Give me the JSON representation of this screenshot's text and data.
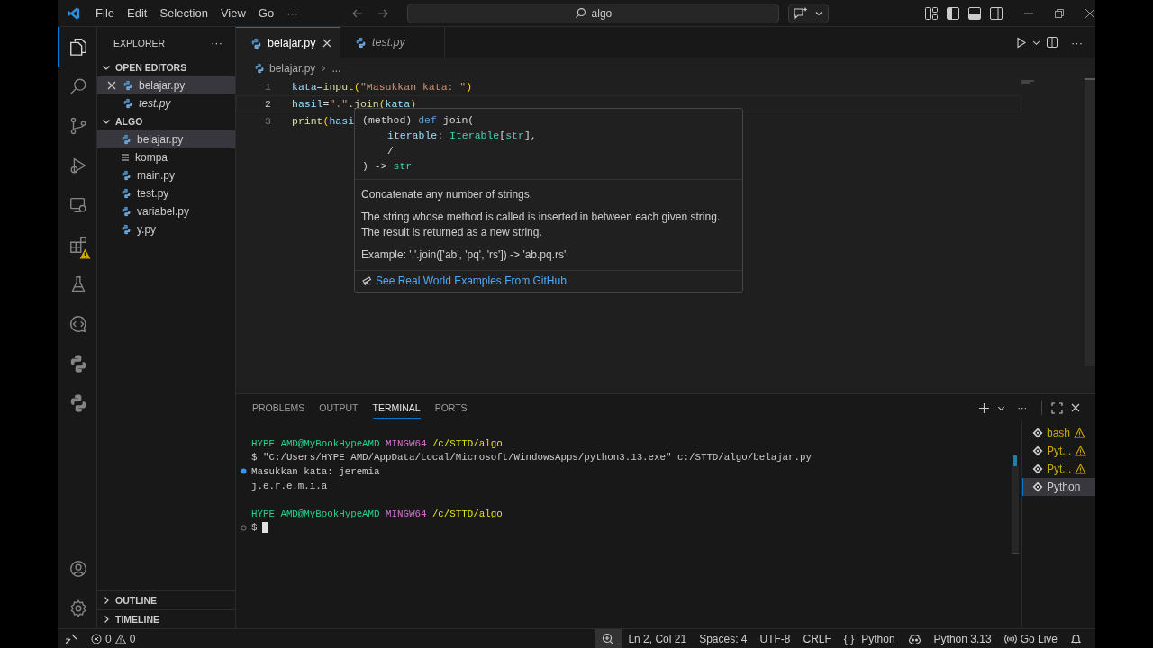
{
  "title_bar": {
    "menus": [
      "File",
      "Edit",
      "Selection",
      "View",
      "Go"
    ],
    "more": "···",
    "search": "algo"
  },
  "activity_bar": {
    "top": [
      {
        "kind": "files",
        "selected": true,
        "warning": false
      },
      {
        "kind": "search",
        "selected": false,
        "warning": false
      },
      {
        "kind": "source-control",
        "selected": false,
        "warning": false
      },
      {
        "kind": "run-debug",
        "selected": false,
        "warning": false
      },
      {
        "kind": "remote",
        "selected": false,
        "warning": false
      },
      {
        "kind": "extensions",
        "selected": false,
        "warning": true
      },
      {
        "kind": "testing",
        "selected": false,
        "warning": false
      },
      {
        "kind": "chat",
        "selected": false,
        "warning": false
      },
      {
        "kind": "python",
        "selected": false,
        "warning": false
      },
      {
        "kind": "python",
        "selected": false,
        "warning": false
      }
    ],
    "bottom": [
      {
        "kind": "account"
      },
      {
        "kind": "settings"
      }
    ]
  },
  "explorer": {
    "title": "EXPLORER",
    "more": "···",
    "sections": [
      {
        "title": "OPEN EDITORS",
        "expanded": true,
        "items": [
          {
            "name": "belajar.py",
            "kind": "python",
            "selected": true,
            "preview": false,
            "closable": true
          },
          {
            "name": "test.py",
            "kind": "python",
            "selected": false,
            "preview": true,
            "closable": false
          }
        ]
      },
      {
        "title": "ALGO",
        "expanded": true,
        "items": [
          {
            "name": "belajar.py",
            "kind": "python",
            "selected": true,
            "preview": false
          },
          {
            "name": "kompa",
            "kind": "text",
            "selected": false,
            "preview": false
          },
          {
            "name": "main.py",
            "kind": "python",
            "selected": false,
            "preview": false
          },
          {
            "name": "test.py",
            "kind": "python",
            "selected": false,
            "preview": false
          },
          {
            "name": "variabel.py",
            "kind": "python",
            "selected": false,
            "preview": false
          },
          {
            "name": "y.py",
            "kind": "python",
            "selected": false,
            "preview": false
          }
        ]
      }
    ],
    "bottom_sections": [
      {
        "title": "OUTLINE",
        "expanded": false
      },
      {
        "title": "TIMELINE",
        "expanded": false
      }
    ]
  },
  "tabs": [
    {
      "label": "belajar.py",
      "selected": true,
      "preview": false,
      "closable": true
    },
    {
      "label": "test.py",
      "selected": false,
      "preview": true,
      "closable": false
    }
  ],
  "breadcrumb": {
    "file": "belajar.py",
    "more": "..."
  },
  "editor": {
    "lines": [
      {
        "number": "1",
        "current": false,
        "tokens": [
          {
            "text": "kata",
            "kind": "var"
          },
          {
            "text": "=",
            "kind": "op"
          },
          {
            "text": "input",
            "kind": "fn"
          },
          {
            "text": "(",
            "kind": "paren"
          },
          {
            "text": "\"Masukkan kata: \"",
            "kind": "str"
          },
          {
            "text": ")",
            "kind": "paren"
          }
        ]
      },
      {
        "number": "2",
        "current": true,
        "tokens": [
          {
            "text": "hasil",
            "kind": "var"
          },
          {
            "text": "=",
            "kind": "op"
          },
          {
            "text": "\".\"",
            "kind": "str"
          },
          {
            "text": ".",
            "kind": "op"
          },
          {
            "text": "join",
            "kind": "fn"
          },
          {
            "text": "(",
            "kind": "paren"
          },
          {
            "text": "kata",
            "kind": "var"
          },
          {
            "text": ")",
            "kind": "paren"
          }
        ]
      },
      {
        "number": "3",
        "current": false,
        "tokens": [
          {
            "text": "print",
            "kind": "fn"
          },
          {
            "text": "(",
            "kind": "paren"
          },
          {
            "text": "hasi",
            "kind": "var"
          }
        ]
      }
    ]
  },
  "hover": {
    "signature": [
      {
        "indented": false,
        "tokens": [
          {
            "text": "(method) ",
            "kind": "plain"
          },
          {
            "text": "def",
            "kind": "keyword"
          },
          {
            "text": " join(",
            "kind": "plain"
          }
        ]
      },
      {
        "indented": true,
        "tokens": [
          {
            "text": "iterable",
            "kind": "param"
          },
          {
            "text": ": ",
            "kind": "plain"
          },
          {
            "text": "Iterable",
            "kind": "type"
          },
          {
            "text": "[",
            "kind": "plain"
          },
          {
            "text": "str",
            "kind": "type"
          },
          {
            "text": "],",
            "kind": "plain"
          }
        ]
      },
      {
        "indented": true,
        "tokens": [
          {
            "text": "/",
            "kind": "plain"
          }
        ]
      },
      {
        "indented": false,
        "tokens": [
          {
            "text": ") -> ",
            "kind": "plain"
          },
          {
            "text": "str",
            "kind": "type"
          }
        ]
      }
    ],
    "summary": "Concatenate any number of strings.",
    "details": [
      "The string whose method is called is inserted in between each given string.",
      "The result is returned as a new string."
    ],
    "example": "Example: '.'.join(['ab', 'pq', 'rs']) -> 'ab.pq.rs'",
    "link": "See Real World Examples From GitHub"
  },
  "panel": {
    "tabs": [
      {
        "label": "PROBLEMS",
        "selected": false
      },
      {
        "label": "OUTPUT",
        "selected": false
      },
      {
        "label": "TERMINAL",
        "selected": true
      },
      {
        "label": "PORTS",
        "selected": false
      }
    ],
    "terminal_lines": [
      {
        "kind": "none",
        "spaced": false,
        "cursor": false,
        "segments": [
          {
            "text": "HYPE AMD@MyBookHypeAMD ",
            "kind": "user"
          },
          {
            "text": "MINGW64 ",
            "kind": "system"
          },
          {
            "text": "/c/STTD/algo",
            "kind": "path"
          }
        ]
      },
      {
        "kind": "none",
        "spaced": false,
        "cursor": false,
        "segments": [
          {
            "text": "$ \"C:/Users/HYPE AMD/AppData/Local/Microsoft/WindowsApps/python3.13.exe\" c:/STTD/algo/belajar.py",
            "kind": "plain"
          }
        ]
      },
      {
        "kind": "success",
        "spaced": false,
        "cursor": false,
        "segments": [
          {
            "text": "Masukkan kata: jeremia",
            "kind": "plain"
          }
        ]
      },
      {
        "kind": "none",
        "spaced": false,
        "cursor": false,
        "segments": [
          {
            "text": "j.e.r.e.m.i.a",
            "kind": "plain"
          }
        ]
      },
      {
        "kind": "none",
        "spaced": true,
        "cursor": false,
        "segments": [
          {
            "text": "HYPE AMD@MyBookHypeAMD ",
            "kind": "user"
          },
          {
            "text": "MINGW64 ",
            "kind": "system"
          },
          {
            "text": "/c/STTD/algo",
            "kind": "path"
          }
        ]
      },
      {
        "kind": "idle",
        "spaced": false,
        "cursor": true,
        "segments": [
          {
            "text": "$",
            "kind": "plain"
          }
        ]
      }
    ],
    "terminals": [
      {
        "label": "bash",
        "warning": true,
        "selected": false
      },
      {
        "label": "Pyt...",
        "warning": true,
        "selected": false
      },
      {
        "label": "Pyt...",
        "warning": true,
        "selected": false
      },
      {
        "label": "Python",
        "warning": false,
        "selected": true
      }
    ]
  },
  "status_bar": {
    "errors": "0",
    "warnings": "0",
    "items": [
      {
        "kind": "zoom"
      },
      {
        "kind": "text",
        "text": "Ln 2, Col 21"
      },
      {
        "kind": "text",
        "text": "Spaces: 4"
      },
      {
        "kind": "text",
        "text": "UTF-8"
      },
      {
        "kind": "text",
        "text": "CRLF"
      },
      {
        "kind": "language",
        "icon": "{ }",
        "text": "Python"
      },
      {
        "kind": "copilot"
      },
      {
        "kind": "text",
        "text": "Python 3.13"
      },
      {
        "kind": "broadcast",
        "text": "Go Live"
      },
      {
        "kind": "bell"
      }
    ]
  }
}
